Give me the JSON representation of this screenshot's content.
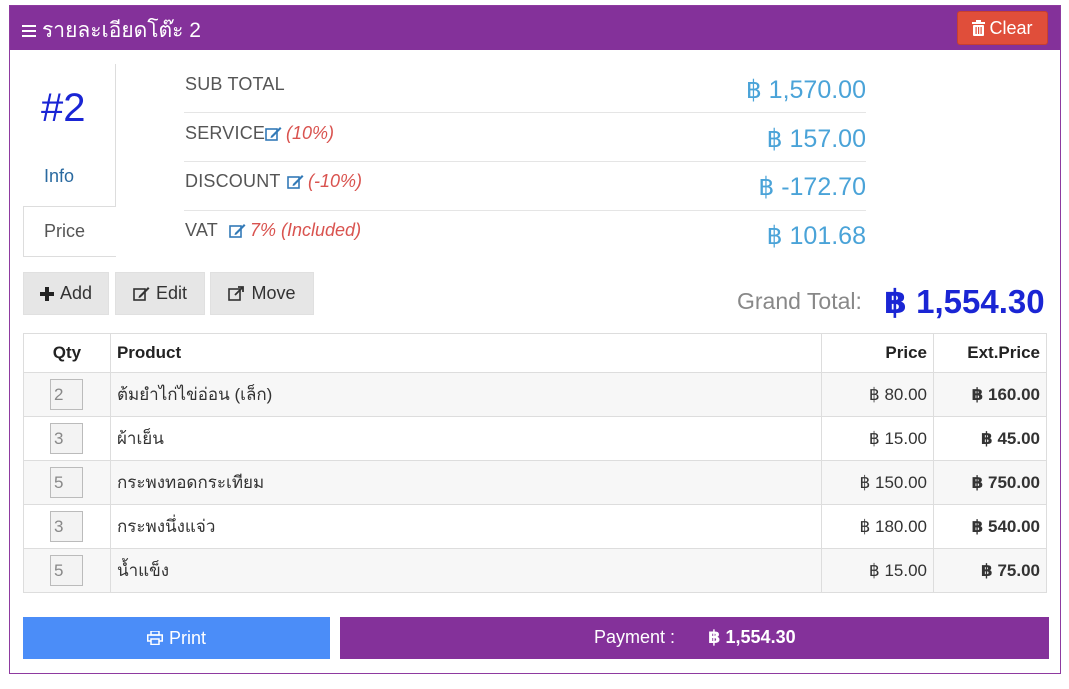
{
  "header": {
    "title": "รายละเอียดโต๊ะ 2",
    "clear_label": "Clear"
  },
  "table_number": "#2",
  "tabs": {
    "info": "Info",
    "price": "Price"
  },
  "summary": {
    "subtotal": {
      "label": "SUB TOTAL",
      "value": "฿ 1,570.00"
    },
    "service": {
      "label": "SERVICE",
      "note": "(10%)",
      "value": "฿ 157.00"
    },
    "discount": {
      "label": "DISCOUNT",
      "note": "(-10%)",
      "value": "฿ -172.70"
    },
    "vat": {
      "label": "VAT",
      "note": "7% (Included)",
      "value": "฿ 101.68"
    }
  },
  "actions": {
    "add": "Add",
    "edit": "Edit",
    "move": "Move"
  },
  "grand_total": {
    "label": "Grand Total:",
    "value": "฿ 1,554.30"
  },
  "columns": {
    "qty": "Qty",
    "product": "Product",
    "price": "Price",
    "ext": "Ext.Price"
  },
  "items": [
    {
      "qty": "2",
      "product": "ต้มยำไก่ไข่อ่อน (เล็ก)",
      "price": "฿ 80.00",
      "ext": "฿ 160.00"
    },
    {
      "qty": "3",
      "product": "ผ้าเย็น",
      "price": "฿ 15.00",
      "ext": "฿ 45.00"
    },
    {
      "qty": "5",
      "product": "กระพงทอดกระเทียม",
      "price": "฿ 150.00",
      "ext": "฿ 750.00"
    },
    {
      "qty": "3",
      "product": "กระพงนึ่งแจ่ว",
      "price": "฿ 180.00",
      "ext": "฿ 540.00"
    },
    {
      "qty": "5",
      "product": "น้ำแข็ง",
      "price": "฿ 15.00",
      "ext": "฿ 75.00"
    }
  ],
  "footer": {
    "print": "Print",
    "payment_label": "Payment :",
    "payment_amount": "฿ 1,554.30"
  }
}
